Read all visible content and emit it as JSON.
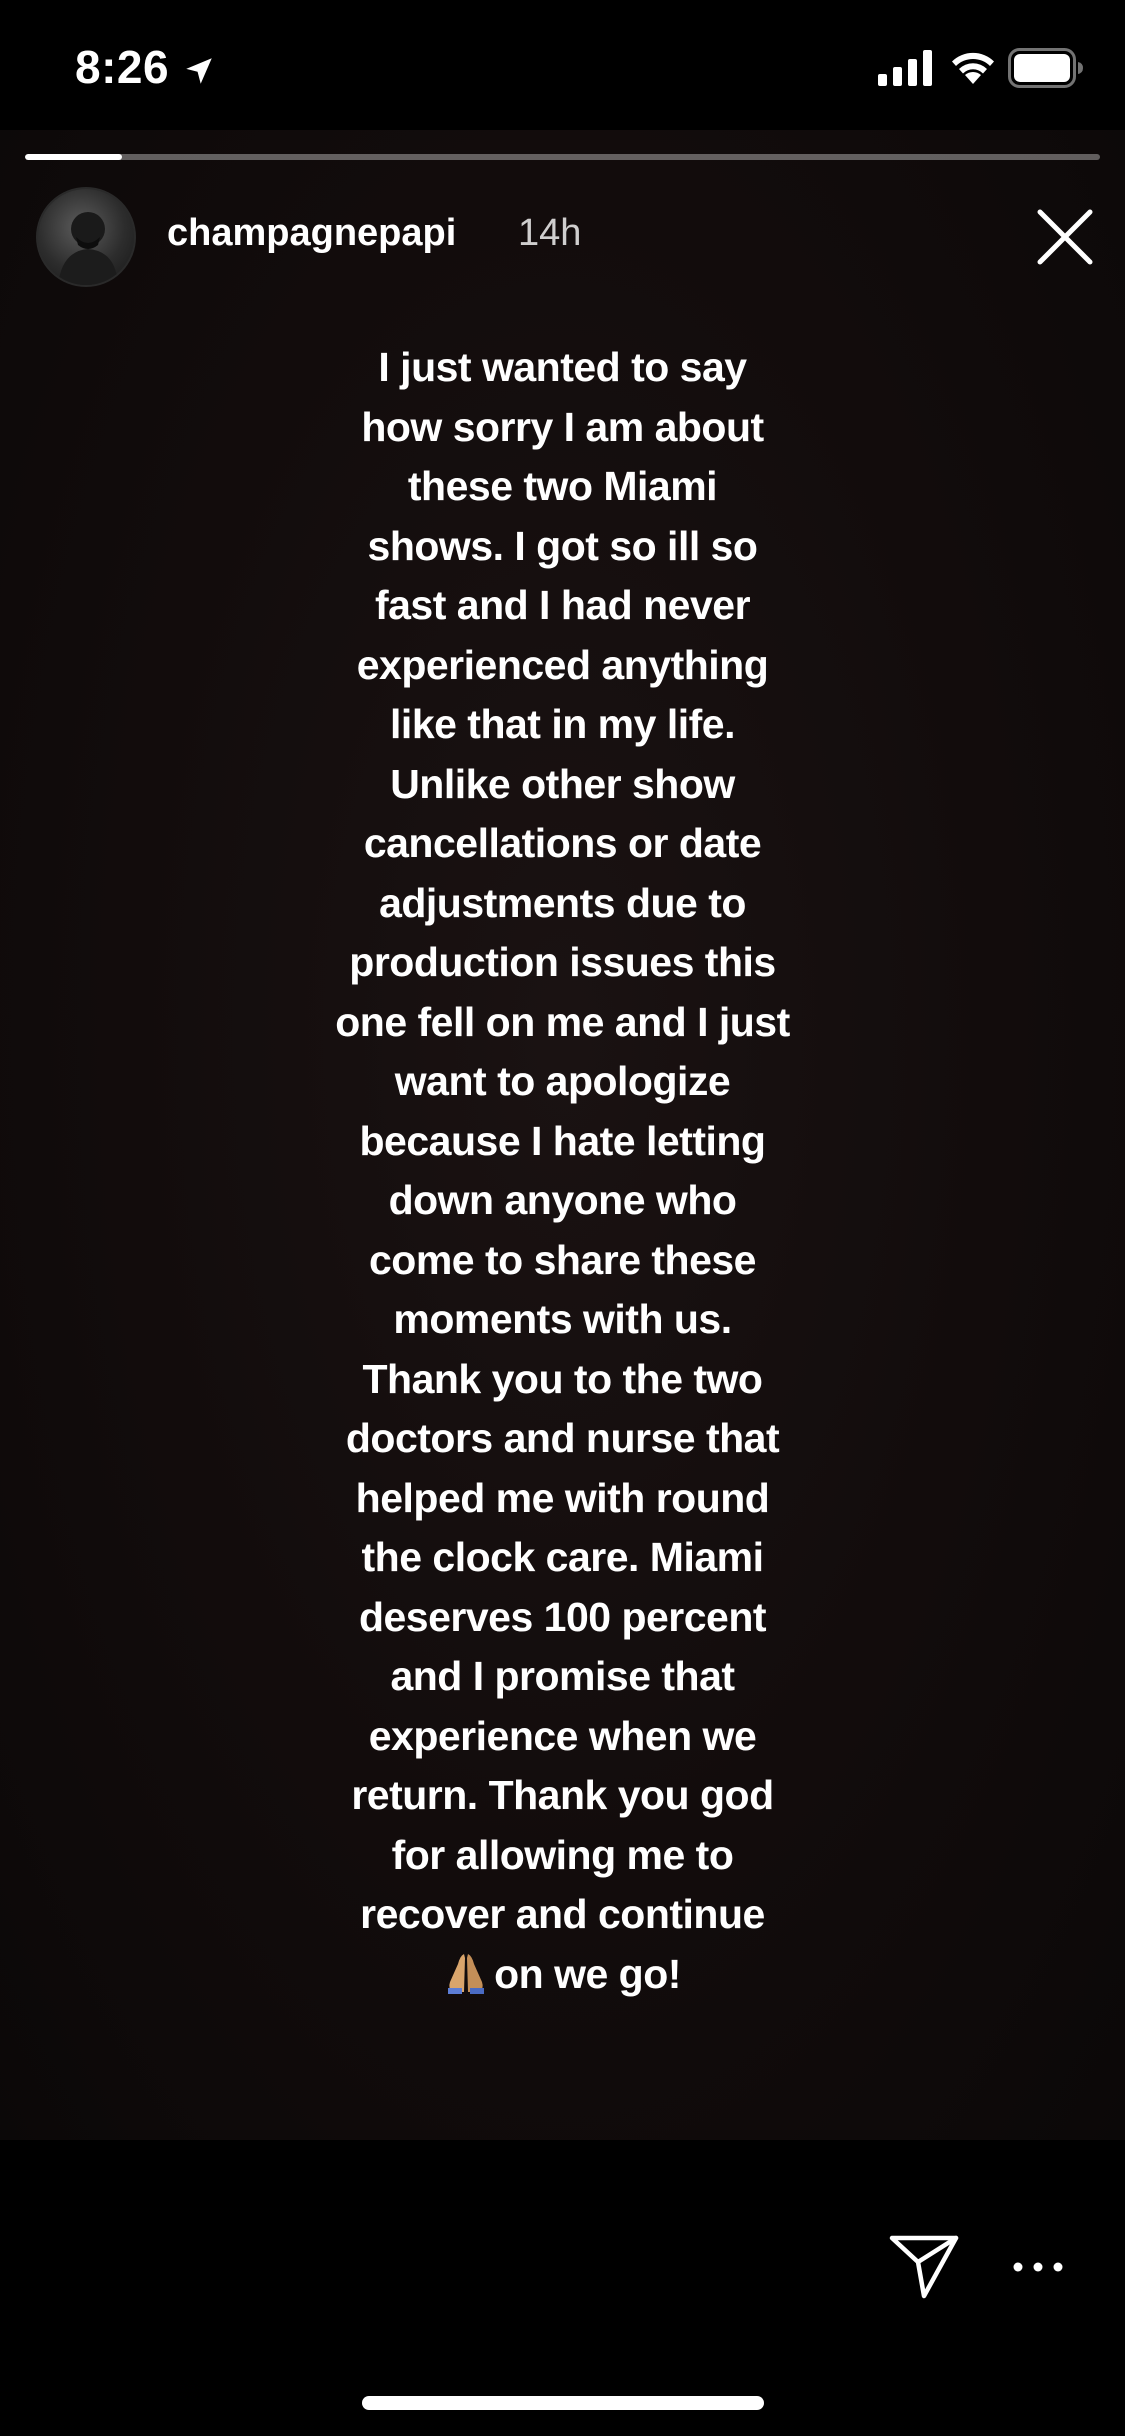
{
  "status_bar": {
    "time": "8:26",
    "icons": [
      "location-arrow-icon",
      "cellular-signal-icon",
      "wifi-icon",
      "battery-icon"
    ]
  },
  "story": {
    "progress_fraction": 0.09,
    "username": "champagnepapi",
    "time_ago": "14h",
    "lines": [
      "I just wanted to say",
      "how sorry I am about",
      "these two Miami",
      "shows. I got so ill so",
      "fast and I had never",
      "experienced anything",
      "like that in my life.",
      "Unlike other show",
      "cancellations or date",
      "adjustments due to",
      "production issues this",
      "one fell on me and I just",
      "want to apologize",
      "because I hate letting",
      "down anyone who",
      "come to share these",
      "moments with us.",
      "Thank you to the two",
      "doctors and nurse that",
      "helped me with round",
      "the clock care. Miami",
      "deserves 100 percent",
      "and I promise that",
      "experience when we",
      "return. Thank you god",
      "for allowing me to",
      "recover and continue"
    ],
    "last_line_emoji": "folded-hands-emoji",
    "last_line_text": "on we go!"
  },
  "colors": {
    "background": "#000000",
    "story_background": "#120c0c",
    "text": "#ffffff"
  }
}
